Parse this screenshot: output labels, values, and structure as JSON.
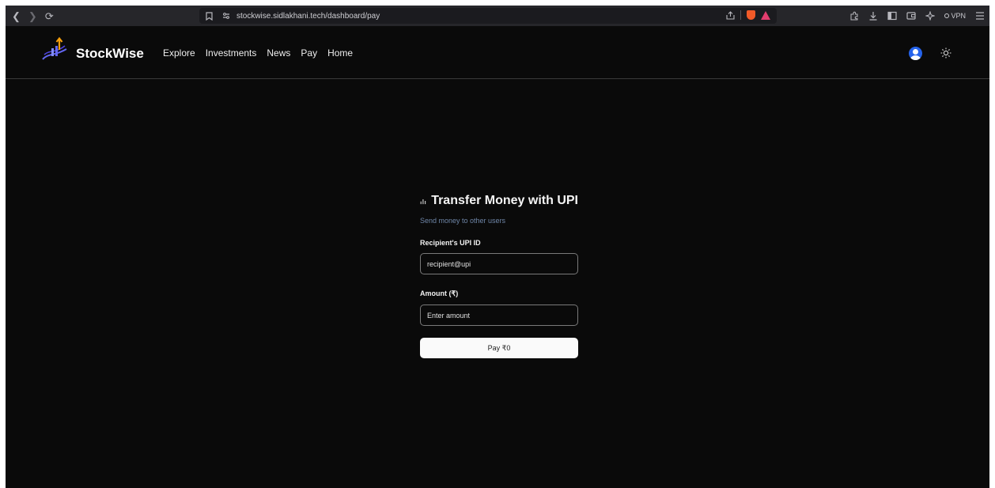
{
  "browser": {
    "url": "stockwise.sidlakhani.tech/dashboard/pay",
    "vpn_label": "VPN"
  },
  "header": {
    "brand": "StockWise",
    "nav": [
      "Explore",
      "Investments",
      "News",
      "Pay",
      "Home"
    ]
  },
  "payment": {
    "title": "Transfer Money with UPI",
    "subtitle": "Send money to other users",
    "upi_label": "Recipient's UPI ID",
    "upi_placeholder": "recipient@upi",
    "amount_label": "Amount (₹)",
    "amount_placeholder": "Enter amount",
    "pay_button": "Pay ₹0"
  },
  "colors": {
    "background": "#0a0a0a",
    "accent_blue": "#2563eb",
    "button_bg": "#fafafa",
    "subtitle": "#6f86a8"
  }
}
